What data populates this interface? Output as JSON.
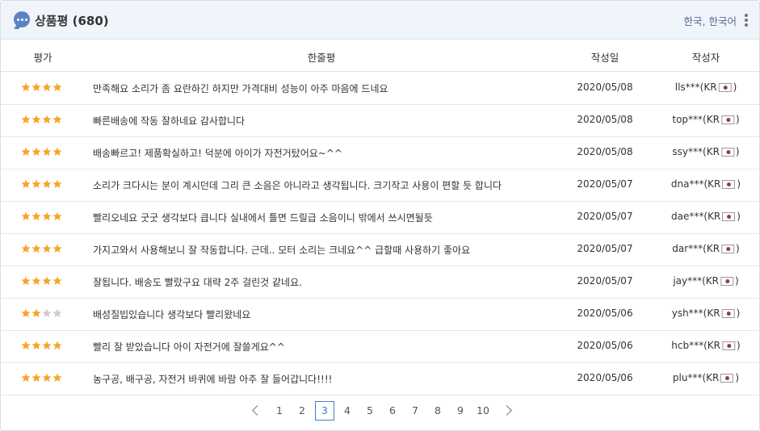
{
  "header": {
    "title": "상품평 (680)",
    "locale": "한국, 한국어",
    "icon": "chat-bubble-icon",
    "menu_icon": "kebab-menu-icon"
  },
  "columns": {
    "rating": "평가",
    "review": "한줄평",
    "date": "작성일",
    "author": "작성자"
  },
  "colors": {
    "star_filled": "#f5a623",
    "star_empty": "#cccccc",
    "accent": "#3d7fc9",
    "header_bg": "#f0f4fb"
  },
  "reviews": [
    {
      "stars": 4,
      "text": "만족해요 소리가 좀 요란하긴 하지만 가격대비 성능이 아주 마음에 드네요",
      "date": "2020/05/08",
      "author_prefix": "lls***(KR",
      "author_suffix": ")"
    },
    {
      "stars": 4,
      "text": "빠른배송에 작동 잘하네요 감사합니다",
      "date": "2020/05/08",
      "author_prefix": "top***(KR",
      "author_suffix": ")"
    },
    {
      "stars": 4,
      "text": "배송빠르고! 제품확실하고! 덕분에 아이가 자전거탔어요~^^",
      "date": "2020/05/08",
      "author_prefix": "ssy***(KR",
      "author_suffix": ")"
    },
    {
      "stars": 4,
      "text": "소리가 크다시는 분이 계시던데 그리 큰 소음은 아니라고 생각됩니다. 크기작고 사용이 편할 듯 합니다",
      "date": "2020/05/07",
      "author_prefix": "dna***(KR",
      "author_suffix": ")"
    },
    {
      "stars": 4,
      "text": "빨리오네요 굿굿 생각보다 큽니다 실내에서 틀면 드릴급 소음이니 밖에서 쓰시면될듯",
      "date": "2020/05/07",
      "author_prefix": "dae***(KR",
      "author_suffix": ")"
    },
    {
      "stars": 4,
      "text": "가지고와서 사용해보니 잘 작동합니다. 근데.. 모터 소리는 크네요^^ 급할때 사용하기 좋아요",
      "date": "2020/05/07",
      "author_prefix": "dar***(KR",
      "author_suffix": ")"
    },
    {
      "stars": 4,
      "text": "잘됩니다. 배송도 빨랐구요 대략 2주 걸린것 같네요.",
      "date": "2020/05/07",
      "author_prefix": "jay***(KR",
      "author_suffix": ")"
    },
    {
      "stars": 2,
      "text": "배성질빕있습니다 생각보다 빨리왔네요",
      "date": "2020/05/06",
      "author_prefix": "ysh***(KR",
      "author_suffix": ")"
    },
    {
      "stars": 4,
      "text": "빨리 잘 받았습니다 아이 자전거에 잘쓸게요^^",
      "date": "2020/05/06",
      "author_prefix": "hcb***(KR",
      "author_suffix": ")"
    },
    {
      "stars": 4,
      "text": "농구공, 배구공, 자전거 바퀴에 바람 아주 잘 들어갑니다!!!!",
      "date": "2020/05/06",
      "author_prefix": "plu***(KR",
      "author_suffix": ")"
    }
  ],
  "pagination": {
    "prev_icon": "chevron-left-icon",
    "next_icon": "chevron-right-icon",
    "pages": [
      "1",
      "2",
      "3",
      "4",
      "5",
      "6",
      "7",
      "8",
      "9",
      "10"
    ],
    "current": "3"
  }
}
